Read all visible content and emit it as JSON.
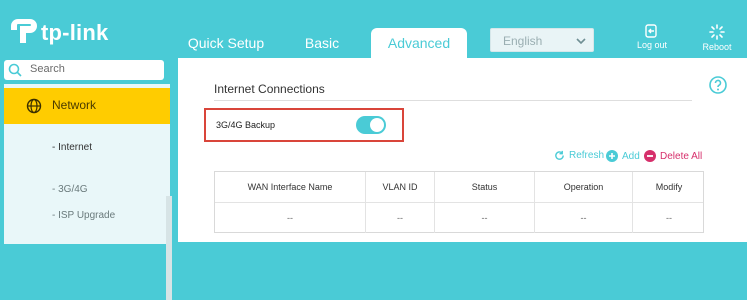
{
  "brand": {
    "name": "tp-link",
    "color": "#4acbd6"
  },
  "nav": {
    "tabs": [
      {
        "label": "Quick Setup"
      },
      {
        "label": "Basic"
      },
      {
        "label": "Advanced",
        "active": true
      }
    ],
    "language": {
      "selected": "English"
    },
    "logout_label": "Log out",
    "reboot_label": "Reboot"
  },
  "sidebar": {
    "search_placeholder": "Search",
    "section": {
      "label": "Network",
      "icon": "globe-icon"
    },
    "items": [
      {
        "label": "- Internet"
      },
      {
        "label": "- 3G/4G"
      },
      {
        "label": "- ISP Upgrade"
      }
    ]
  },
  "main": {
    "section_title": "Internet Connections",
    "backup": {
      "label": "3G/4G Backup",
      "enabled": true
    },
    "actions": {
      "refresh": "Refresh",
      "add": "Add",
      "delete_all": "Delete All"
    },
    "table": {
      "columns": [
        "WAN Interface Name",
        "VLAN ID",
        "Status",
        "Operation",
        "Modify"
      ],
      "rows": [
        [
          "--",
          "--",
          "--",
          "--",
          "--"
        ]
      ]
    }
  },
  "colors": {
    "accent": "#4acbd6",
    "highlight": "#ffcc00",
    "danger": "#d62f6b",
    "red_outline": "#d9453a"
  }
}
